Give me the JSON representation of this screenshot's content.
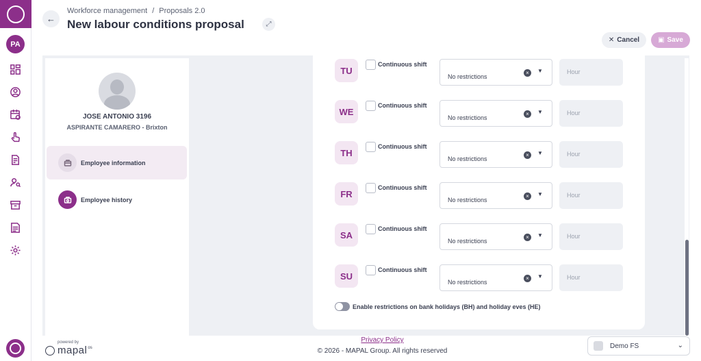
{
  "rail": {
    "avatar_initials": "PA",
    "icons": [
      "dashboard-icon",
      "user-circle-icon",
      "calendar-icon",
      "touch-icon",
      "document-icon",
      "user-search-icon",
      "archive-icon",
      "report-icon",
      "settings-icon"
    ]
  },
  "header": {
    "breadcrumb": [
      "Workforce management",
      "Proposals 2.0"
    ],
    "breadcrumb_separator": "/",
    "title": "New labour conditions proposal",
    "cancel_label": "Cancel",
    "save_label": "Save"
  },
  "employee": {
    "name": "JOSE ANTONIO 3196",
    "role": "ASPIRANTE CAMARERO - Brixton",
    "menu": [
      {
        "label": "Employee information",
        "active": true
      },
      {
        "label": "Employee history",
        "active": false
      }
    ]
  },
  "days": [
    {
      "code": "TU",
      "shift_label": "Continuous shift",
      "restriction": "No restrictions",
      "hour_placeholder": "Hour"
    },
    {
      "code": "WE",
      "shift_label": "Continuous shift",
      "restriction": "No restrictions",
      "hour_placeholder": "Hour"
    },
    {
      "code": "TH",
      "shift_label": "Continuous shift",
      "restriction": "No restrictions",
      "hour_placeholder": "Hour"
    },
    {
      "code": "FR",
      "shift_label": "Continuous shift",
      "restriction": "No restrictions",
      "hour_placeholder": "Hour"
    },
    {
      "code": "SA",
      "shift_label": "Continuous shift",
      "restriction": "No restrictions",
      "hour_placeholder": "Hour"
    },
    {
      "code": "SU",
      "shift_label": "Continuous shift",
      "restriction": "No restrictions",
      "hour_placeholder": "Hour"
    }
  ],
  "bank_holiday_toggle": {
    "label": "Enable restrictions on bank holidays (BH) and holiday eves (HE)",
    "enabled": false
  },
  "footer": {
    "powered_by": "powered by",
    "brand": "mapal",
    "brand_suffix": "os",
    "privacy": "Privacy Policy",
    "copyright": "© 2026 - MAPAL Group. All rights reserved",
    "org": "Demo FS"
  },
  "colors": {
    "brand": "#8c2f8a",
    "save_disabled": "#d7a9d6",
    "day_badge_bg": "#f3e6f2"
  }
}
